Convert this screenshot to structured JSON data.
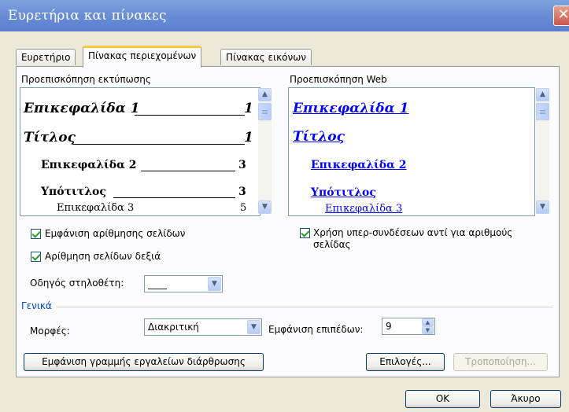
{
  "window": {
    "title": "Ευρετήρια και πίνακες",
    "close_glyph": "✕"
  },
  "tabs": [
    {
      "label": "Ευρετήριο",
      "active": false
    },
    {
      "label": "Πίνακας περιεχομένων",
      "active": true
    },
    {
      "label": "Πίνακας εικόνων",
      "active": false
    }
  ],
  "print_preview": {
    "label": "Προεπισκόπηση εκτύπωσης",
    "lines": [
      {
        "text": "Επικεφαλίδα 1",
        "page": "1"
      },
      {
        "text": "Τίτλος",
        "page": "1"
      },
      {
        "text": "Επικεφαλίδα 2",
        "page": "3"
      },
      {
        "text": "Υπότιτλος",
        "page": "3"
      },
      {
        "text": "Επικεφαλίδα 3",
        "page": "5"
      }
    ]
  },
  "web_preview": {
    "label": "Προεπισκόπηση Web",
    "lines": [
      {
        "text": "Επικεφαλίδα 1"
      },
      {
        "text": "Τίτλος"
      },
      {
        "text": "Επικεφαλίδα 2"
      },
      {
        "text": "Υπότιτλος"
      },
      {
        "text": "Επικεφαλίδα 3"
      }
    ],
    "link_color": "#0000ff"
  },
  "options": {
    "show_page_numbers": {
      "label": "Εμφάνιση αρίθμησης σελίδων",
      "checked": true
    },
    "right_align": {
      "label": "Αρίθμηση σελίδων δεξιά",
      "checked": true
    },
    "tab_leader": {
      "label": "Οδηγός στηλοθέτη:",
      "value": "____"
    },
    "hyperlinks": {
      "label_line1": "Χρήση υπερ-συνδέσεων αντί για αριθμούς",
      "label_line2": "σελίδας",
      "checked": true
    }
  },
  "general": {
    "label": "Γενικά",
    "formats": {
      "label": "Μορφές:",
      "value": "Διακριτική"
    },
    "show_levels": {
      "label": "Εμφάνιση επιπέδων:",
      "value": "9"
    }
  },
  "buttons": {
    "outlining_toolbar": "Εμφάνιση γραμμής εργαλείων διάρθρωσης",
    "options": "Επιλογές...",
    "modify": "Τροποποίηση...",
    "ok": "OK",
    "cancel": "Άκυρο"
  },
  "colors": {
    "titlebar": "#6a8fd6",
    "group_label": "#0046d5"
  }
}
